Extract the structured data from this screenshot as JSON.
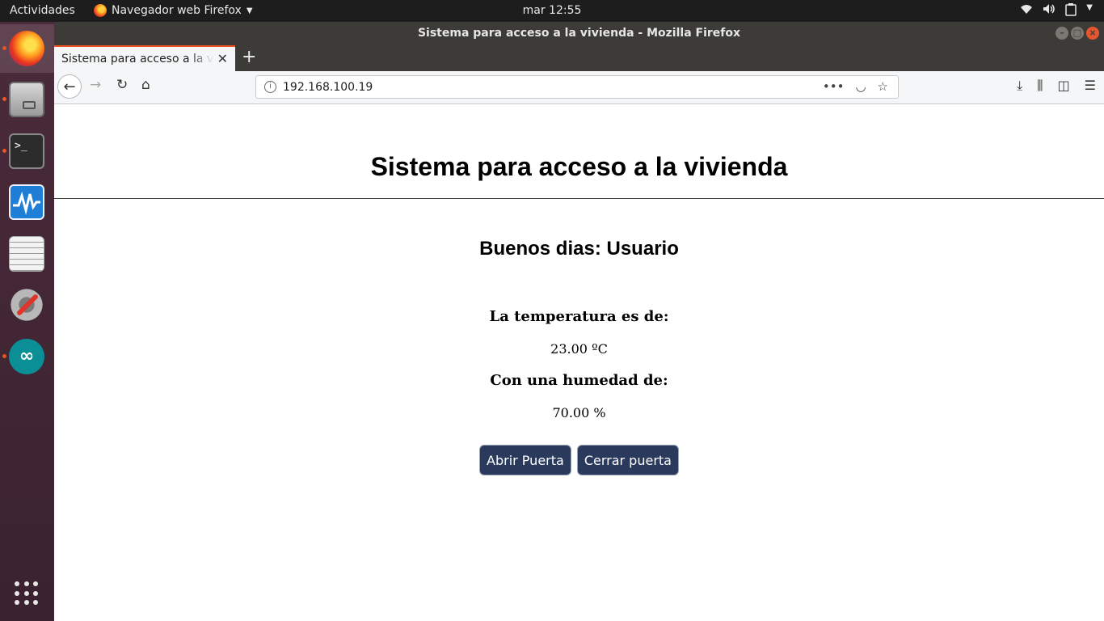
{
  "topbar": {
    "activities": "Actividades",
    "app_menu": "Navegador web Firefox",
    "clock": "mar 12:55"
  },
  "window": {
    "title": "Sistema para acceso a la vivienda - Mozilla Firefox"
  },
  "tab": {
    "label": "Sistema para acceso a la vivienda"
  },
  "navbar": {
    "url": "192.168.100.19"
  },
  "page": {
    "title": "Sistema para acceso a la vivienda",
    "greeting_prefix": "Buenos dias:",
    "greeting_user": "Usuario",
    "temp_label": "La temperatura es de:",
    "temp_value": "23.00 ºC",
    "hum_label": "Con una humedad de:",
    "hum_value": "70.00 %",
    "open_button": "Abrir Puerta",
    "close_button": "Cerrar puerta"
  },
  "colors": {
    "button_bg": "#2a3a5c",
    "accent": "#e95420",
    "titlebar": "#3c3b37"
  },
  "icons": [
    "firefox-icon",
    "files-icon",
    "terminal-icon",
    "system-monitor-icon",
    "text-editor-icon",
    "settings-icon",
    "arduino-icon",
    "show-apps-icon"
  ]
}
